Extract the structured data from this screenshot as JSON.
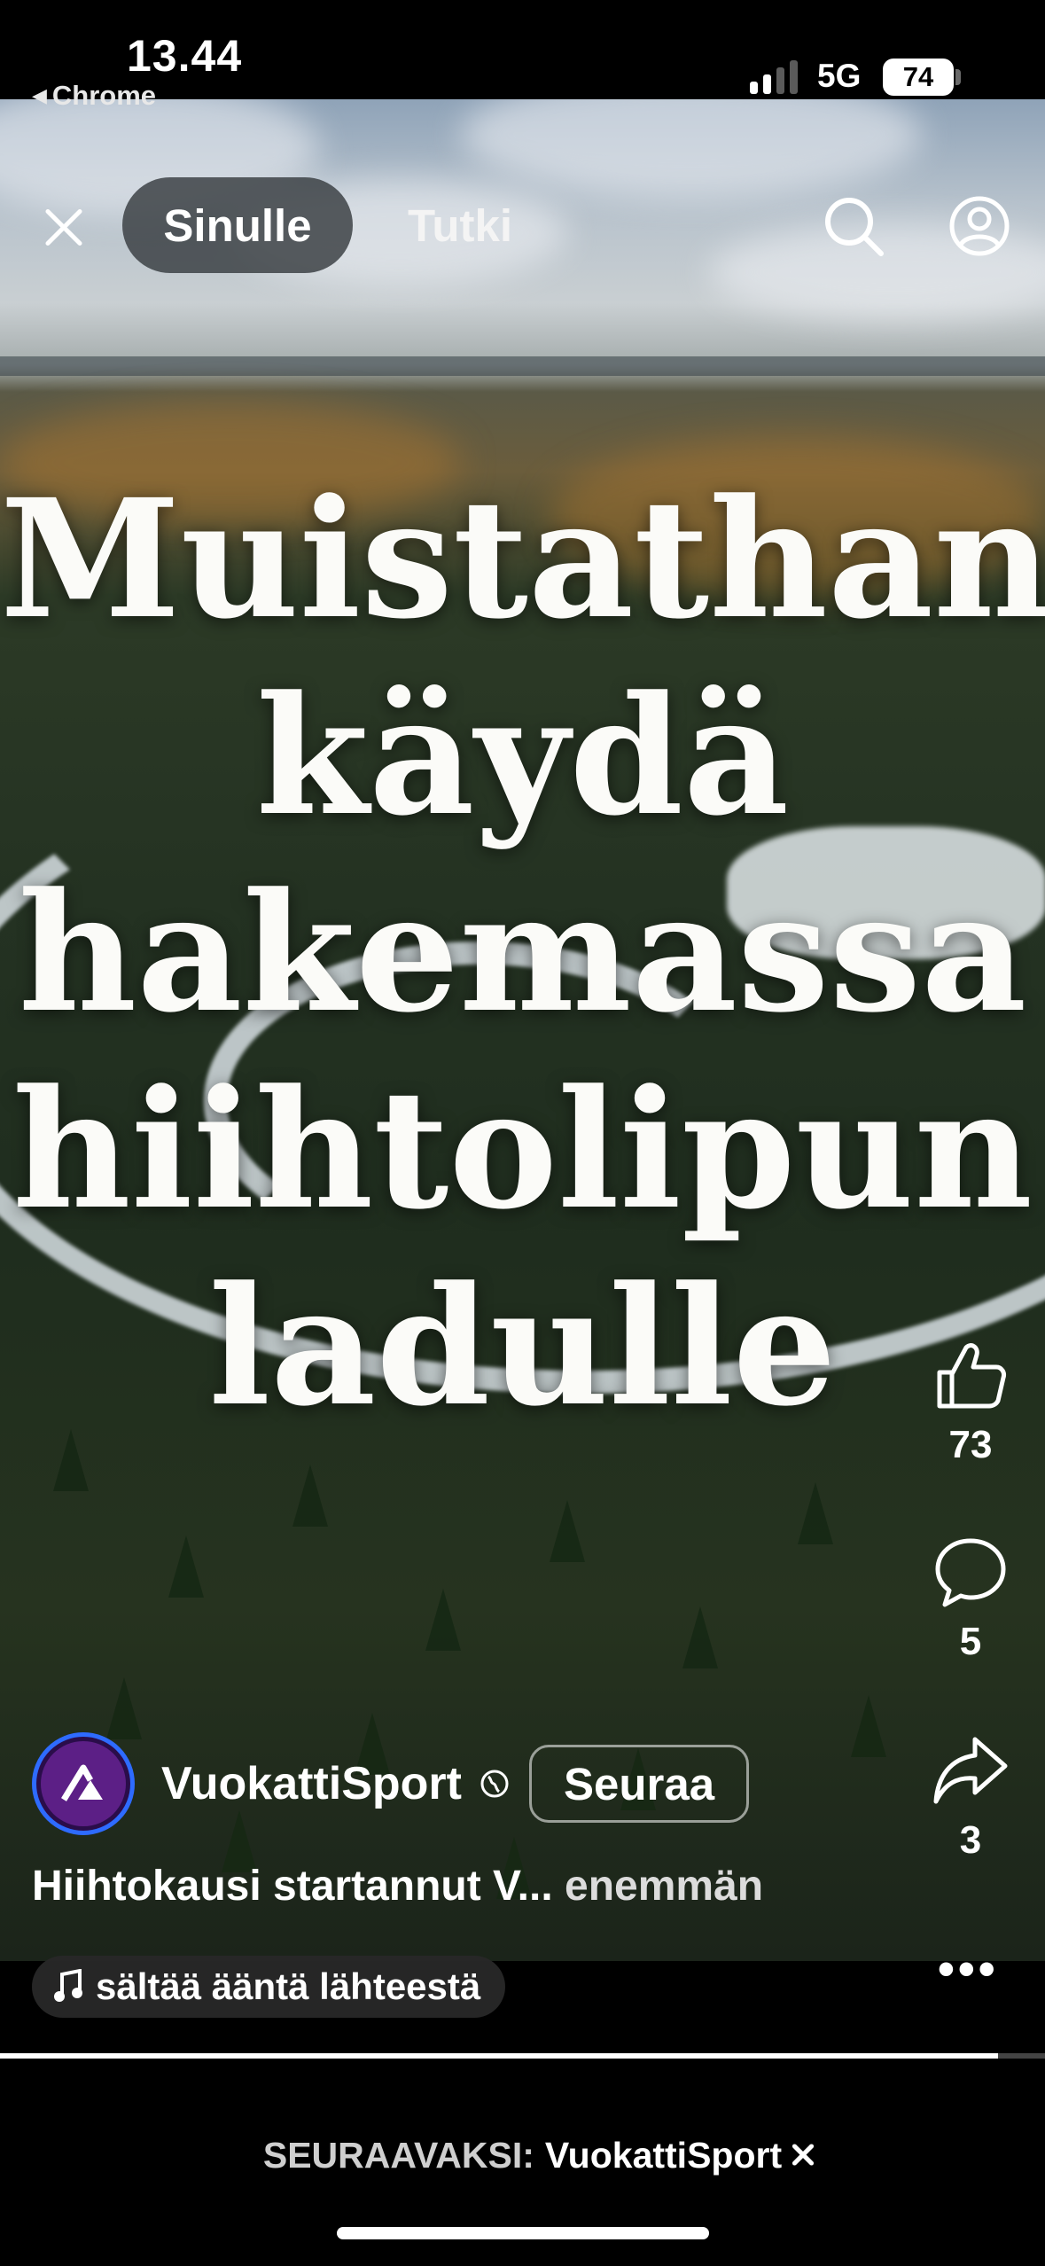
{
  "status_bar": {
    "time": "13.44",
    "back_app": "Chrome",
    "network": "5G",
    "battery": "74"
  },
  "nav": {
    "tabs": [
      {
        "label": "Sinulle",
        "active": true
      },
      {
        "label": "Tutki",
        "active": false
      }
    ],
    "icons": [
      "close-icon",
      "search-icon",
      "profile-icon"
    ]
  },
  "video": {
    "overlay_lines": [
      "Muistathan",
      "käydä",
      "hakemassa",
      "hiihtolipun",
      "ladulle"
    ],
    "likes": "73",
    "comments": "5",
    "shares": "3",
    "author": "VuokattiSport",
    "follow_label": "Seuraa",
    "caption": "Hiihtokausi startannut V...",
    "caption_more": "enemmän",
    "audio": "sältää ääntä lähteestä",
    "progress": 0.955
  },
  "up_next": {
    "label": "SEURAAVAKSI:",
    "name": "VuokattiSport"
  },
  "colors": {
    "avatar_ring": "#2e6bff",
    "avatar_bg": "#5c1f86",
    "background": "#000000"
  }
}
